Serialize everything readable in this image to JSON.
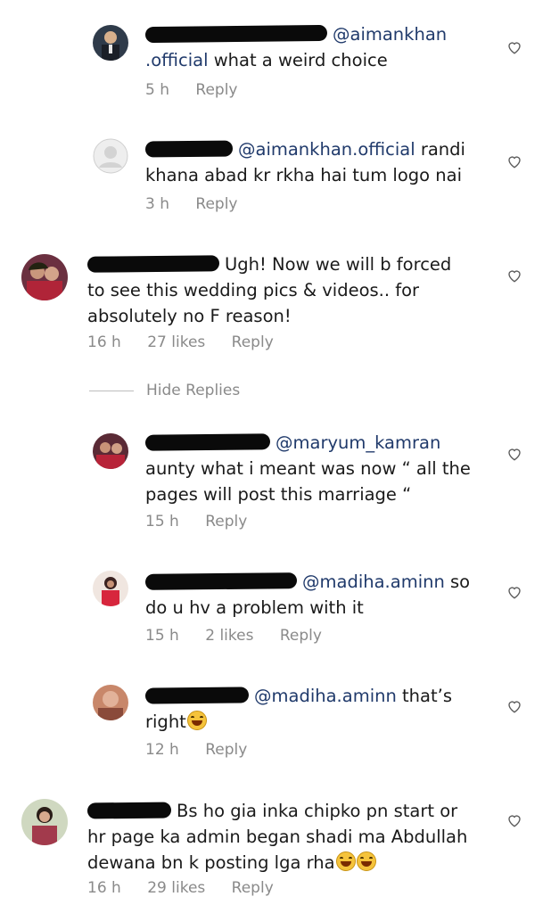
{
  "comments": [
    {
      "mention": "@aimankhan",
      "mention2": ".official",
      "text": " what a weird choice",
      "time": "5 h",
      "likes": "",
      "reply": "Reply"
    },
    {
      "mention": "@aimankhan.official",
      "text1": " randi",
      "text2": "khana abad kr rkha hai tum logo nai",
      "time": "3 h",
      "reply": "Reply"
    },
    {
      "text1": "Ugh! Now we will b forced",
      "text2": "to see this wedding pics & videos.. for",
      "text3": "absolutely no F reason!",
      "time": "16 h",
      "likes": "27 likes",
      "reply": "Reply"
    },
    {
      "mention": "@maryum_kamran",
      "text1": "aunty what i meant was now “ all the",
      "text2": "pages will post this marriage “",
      "time": "15 h",
      "reply": "Reply"
    },
    {
      "mention": "@madiha.aminn",
      "text1": " so",
      "text2": "do u hv a problem with it",
      "time": "15 h",
      "likes": "2 likes",
      "reply": "Reply"
    },
    {
      "mention": "@madiha.aminn",
      "text1": " that’s",
      "text2": "right",
      "time": "12 h",
      "reply": "Reply"
    },
    {
      "text1": "Bs ho gia inka chipko pn start or",
      "text2": "hr page ka admin began shadi ma Abdullah",
      "text3": "dewana bn k posting lga rha",
      "time": "16 h",
      "likes": "29 likes",
      "reply": "Reply"
    }
  ],
  "hide_replies": "Hide Replies",
  "icons": {
    "like": "heart-outline-icon",
    "emoji": "grinning-sweat-emoji"
  },
  "colors": {
    "mention": "#203a6b",
    "meta": "#8a8a8a"
  }
}
